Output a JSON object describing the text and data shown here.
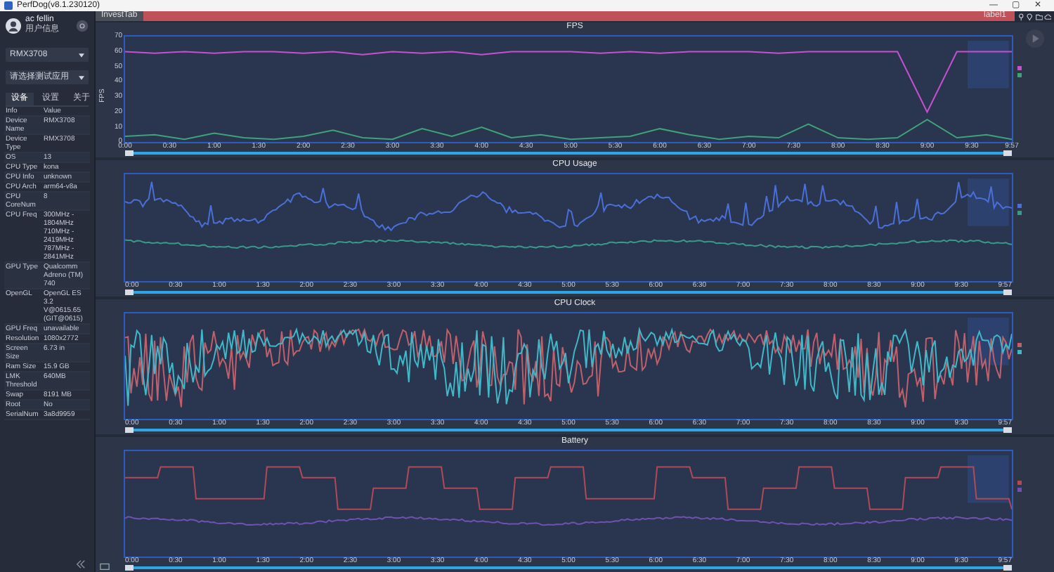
{
  "window": {
    "title": "PerfDog(v8.1.230120)",
    "controls": [
      "—",
      "▢",
      "✕"
    ]
  },
  "user": {
    "name": "ac fellin",
    "subtitle": "用户信息"
  },
  "device_select": {
    "value": "RMX3708"
  },
  "app_select": {
    "placeholder": "请选择测试应用"
  },
  "sidebar_tabs": [
    {
      "label": "设备",
      "selected": true
    },
    {
      "label": "设置",
      "selected": false
    },
    {
      "label": "关于",
      "selected": false
    }
  ],
  "info_table": {
    "columns": [
      "Info",
      "Value"
    ],
    "rows": [
      [
        "Device Name",
        "RMX3708"
      ],
      [
        "Device Type",
        "RMX3708"
      ],
      [
        "OS",
        "13"
      ],
      [
        "CPU Type",
        "kona"
      ],
      [
        "CPU Info",
        "unknown"
      ],
      [
        "CPU Arch",
        "arm64-v8a"
      ],
      [
        "CPU CoreNum",
        "8"
      ],
      [
        "CPU Freq",
        "300MHz - 1804MHz\n710MHz - 2419MHz\n787MHz - 2841MHz"
      ],
      [
        "GPU Type",
        "Qualcomm Adreno (TM) 740"
      ],
      [
        "OpenGL",
        "OpenGL ES 3.2 V@0615.65 (GIT@0615)"
      ],
      [
        "GPU Freq",
        "unavailable"
      ],
      [
        "Resolution",
        "1080x2772"
      ],
      [
        "Screen Size",
        "6.73 in"
      ],
      [
        "Ram Size",
        "15.9 GB"
      ],
      [
        "LMK Threshold",
        "640MB"
      ],
      [
        "Swap",
        "8191 MB"
      ],
      [
        "Root",
        "No"
      ],
      [
        "SerialNum",
        "3a8d9959"
      ]
    ]
  },
  "top_tabs": [
    {
      "label": "InvestTab",
      "selected": false
    },
    {
      "label": "label1",
      "selected": true
    }
  ],
  "charts": [
    {
      "title": "FPS",
      "chart_data": {
        "type": "line",
        "ylabel": "FPS",
        "ylim": [
          0,
          70
        ],
        "yticks": [
          0,
          10,
          20,
          30,
          40,
          50,
          60,
          70
        ],
        "xlim": [
          0,
          597
        ],
        "xticks": [
          {
            "value": 0,
            "label": "0:00"
          },
          {
            "value": 30,
            "label": "0:30"
          },
          {
            "value": 60,
            "label": "1:00"
          },
          {
            "value": 90,
            "label": "1:30"
          },
          {
            "value": 120,
            "label": "2:00"
          },
          {
            "value": 150,
            "label": "2:30"
          },
          {
            "value": 180,
            "label": "3:00"
          },
          {
            "value": 210,
            "label": "3:30"
          },
          {
            "value": 240,
            "label": "4:00"
          },
          {
            "value": 270,
            "label": "4:30"
          },
          {
            "value": 300,
            "label": "5:00"
          },
          {
            "value": 330,
            "label": "5:30"
          },
          {
            "value": 360,
            "label": "6:00"
          },
          {
            "value": 390,
            "label": "6:30"
          },
          {
            "value": 420,
            "label": "7:00"
          },
          {
            "value": 450,
            "label": "7:30"
          },
          {
            "value": 480,
            "label": "8:00"
          },
          {
            "value": 510,
            "label": "8:30"
          },
          {
            "value": 540,
            "label": "9:00"
          },
          {
            "value": 570,
            "label": "9:30"
          },
          {
            "value": 597,
            "label": "9:57"
          }
        ],
        "x": [
          0,
          20,
          40,
          60,
          80,
          100,
          120,
          140,
          160,
          180,
          200,
          220,
          240,
          260,
          280,
          300,
          320,
          340,
          360,
          380,
          400,
          420,
          440,
          460,
          480,
          500,
          520,
          540,
          560,
          580,
          597
        ],
        "series": [
          {
            "color": "#c94fd0",
            "values": [
              60,
              59,
              60,
              59,
              60,
              60,
              59,
              60,
              58,
              60,
              59,
              60,
              58,
              60,
              60,
              60,
              59,
              60,
              59,
              60,
              60,
              60,
              59,
              60,
              60,
              60,
              60,
              20,
              60,
              60,
              60
            ]
          },
          {
            "color": "#3fa37a",
            "values": [
              4,
              5,
              2,
              6,
              3,
              2,
              4,
              8,
              3,
              2,
              9,
              4,
              10,
              3,
              5,
              2,
              3,
              4,
              9,
              5,
              2,
              4,
              3,
              12,
              3,
              2,
              3,
              15,
              3,
              5,
              2
            ]
          }
        ]
      }
    },
    {
      "title": "CPU Usage",
      "xticks": [
        "0:00",
        "0:30",
        "1:00",
        "1:30",
        "2:00",
        "2:30",
        "3:00",
        "3:30",
        "4:00",
        "4:30",
        "5:00",
        "5:30",
        "6:00",
        "6:30",
        "7:00",
        "7:30",
        "8:00",
        "8:30",
        "9:00",
        "9:30",
        "9:57"
      ],
      "series": [
        {
          "kind": "wavy",
          "color": "#4a6fd8"
        },
        {
          "kind": "flat",
          "color": "#3a9a8a"
        }
      ]
    },
    {
      "title": "CPU Clock",
      "xticks": [
        "0:00",
        "0:30",
        "1:00",
        "1:30",
        "2:00",
        "2:30",
        "3:00",
        "3:30",
        "4:00",
        "4:30",
        "5:00",
        "5:30",
        "6:00",
        "6:30",
        "7:00",
        "7:30",
        "8:00",
        "8:30",
        "9:00",
        "9:30",
        "9:57"
      ],
      "series": [
        {
          "kind": "noise",
          "color": "#c0606a"
        },
        {
          "kind": "noise",
          "color": "#40b8c8"
        }
      ]
    },
    {
      "title": "Battery",
      "xticks": [
        "0:00",
        "0:30",
        "1:00",
        "1:30",
        "2:00",
        "2:30",
        "3:00",
        "3:30",
        "4:00",
        "4:30",
        "5:00",
        "5:30",
        "6:00",
        "6:30",
        "7:00",
        "7:30",
        "8:00",
        "8:30",
        "9:00",
        "9:30",
        "9:57"
      ],
      "series": [
        {
          "kind": "steps",
          "color": "#b04a58"
        },
        {
          "kind": "flat",
          "color": "#7050b0"
        }
      ]
    }
  ]
}
